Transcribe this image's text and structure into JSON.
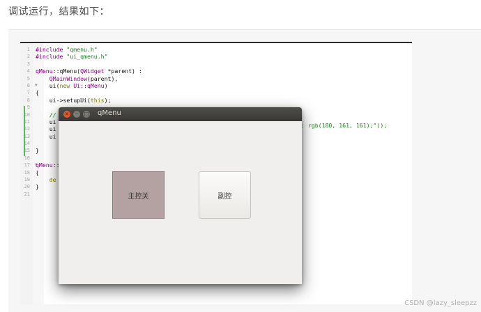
{
  "caption": "调试运行，结果如下：",
  "code_lines": [
    {
      "n": "1",
      "fold": "",
      "parts": [
        {
          "c": "tok-type",
          "t": "#include "
        },
        {
          "c": "tok-str",
          "t": "\"qmenu.h\""
        }
      ]
    },
    {
      "n": "2",
      "fold": "",
      "parts": [
        {
          "c": "tok-type",
          "t": "#include "
        },
        {
          "c": "tok-str",
          "t": "\"ui_qmenu.h\""
        }
      ]
    },
    {
      "n": "3",
      "fold": "",
      "parts": []
    },
    {
      "n": "4",
      "fold": "",
      "parts": [
        {
          "c": "tok-type",
          "t": "qMenu"
        },
        {
          "c": "tok-plain",
          "t": "::qMenu("
        },
        {
          "c": "tok-type",
          "t": "QWidget"
        },
        {
          "c": "tok-plain",
          "t": " *parent) :"
        }
      ]
    },
    {
      "n": "5",
      "fold": "",
      "parts": [
        {
          "c": "tok-plain",
          "t": "    "
        },
        {
          "c": "tok-type",
          "t": "QMainWindow"
        },
        {
          "c": "tok-plain",
          "t": "(parent),"
        }
      ]
    },
    {
      "n": "6",
      "fold": "▼",
      "parts": [
        {
          "c": "tok-plain",
          "t": "    ui("
        },
        {
          "c": "tok-kw",
          "t": "new"
        },
        {
          "c": "tok-plain",
          "t": " "
        },
        {
          "c": "tok-type",
          "t": "Ui::qMenu"
        },
        {
          "c": "tok-plain",
          "t": ")"
        }
      ]
    },
    {
      "n": "7",
      "fold": "",
      "parts": [
        {
          "c": "tok-plain",
          "t": "{"
        }
      ]
    },
    {
      "n": "8",
      "fold": "",
      "parts": [
        {
          "c": "tok-plain",
          "t": "    ui->setupUi("
        },
        {
          "c": "tok-kw",
          "t": "this"
        },
        {
          "c": "tok-plain",
          "t": ");"
        }
      ]
    },
    {
      "n": "9",
      "fold": "",
      "parts": []
    },
    {
      "n": "10",
      "fold": "",
      "parts": [
        {
          "c": "tok-comment",
          "t": "    //"
        }
      ]
    },
    {
      "n": "11",
      "fold": "",
      "parts": [
        {
          "c": "tok-plain",
          "t": "    ui"
        }
      ]
    },
    {
      "n": "12",
      "fold": "",
      "parts": [
        {
          "c": "tok-plain",
          "t": "    ui"
        }
      ]
    },
    {
      "n": "13",
      "fold": "",
      "parts": [
        {
          "c": "tok-plain",
          "t": "    ui"
        }
      ]
    },
    {
      "n": "14",
      "fold": "",
      "parts": []
    },
    {
      "n": "15",
      "fold": "",
      "parts": [
        {
          "c": "tok-plain",
          "t": "}"
        }
      ]
    },
    {
      "n": "16",
      "fold": "",
      "parts": []
    },
    {
      "n": "17",
      "fold": "▼",
      "parts": [
        {
          "c": "tok-type",
          "t": "qMenu"
        },
        {
          "c": "tok-plain",
          "t": "::"
        }
      ]
    },
    {
      "n": "18",
      "fold": "",
      "parts": [
        {
          "c": "tok-plain",
          "t": "{"
        }
      ]
    },
    {
      "n": "19",
      "fold": "",
      "parts": [
        {
          "c": "tok-kw",
          "t": "    de"
        }
      ]
    },
    {
      "n": "20",
      "fold": "",
      "parts": [
        {
          "c": "tok-plain",
          "t": "}"
        }
      ]
    },
    {
      "n": "21",
      "fold": "",
      "parts": []
    }
  ],
  "overflow_code": ": rgb(180, 161, 161);\"));",
  "window": {
    "title": "qMenu",
    "close_glyph": "×",
    "min_glyph": "–",
    "max_glyph": "□",
    "button_main": "主控关",
    "button_sub": "副控"
  },
  "colors": {
    "main_button_bg": "#b4a1a1",
    "titlebar": "#3f3e3a",
    "close_button": "#e25a2b"
  },
  "watermark": "CSDN @lazy_sleepzz"
}
